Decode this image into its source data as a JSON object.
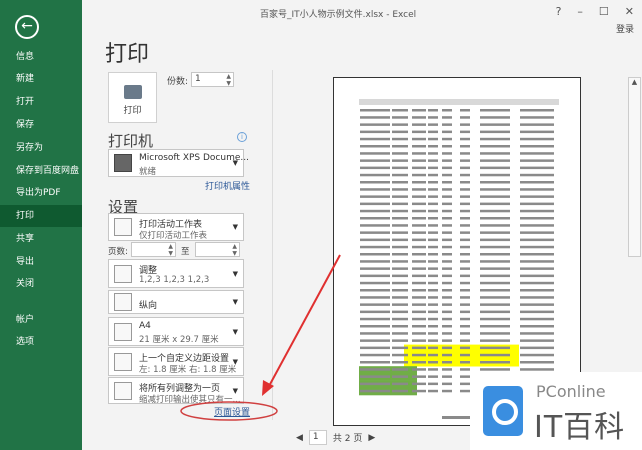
{
  "window": {
    "title": "百家号_IT小人物示例文件.xlsx - Excel",
    "help": "?",
    "minimize": "–",
    "maximize": "☐",
    "close": "✕",
    "login": "登录"
  },
  "sidebar": {
    "back": "←",
    "items": [
      {
        "label": "信息"
      },
      {
        "label": "新建"
      },
      {
        "label": "打开"
      },
      {
        "label": "保存"
      },
      {
        "label": "另存为"
      },
      {
        "label": "保存到百度网盘"
      },
      {
        "label": "导出为PDF"
      },
      {
        "label": "打印"
      },
      {
        "label": "共享"
      },
      {
        "label": "导出"
      },
      {
        "label": "关闭"
      },
      {
        "label": "帐户"
      },
      {
        "label": "选项"
      }
    ]
  },
  "print": {
    "title": "打印",
    "button": "打印",
    "copies_label": "份数:",
    "copies": "1",
    "printer_heading": "打印机",
    "printer_name": "Microsoft XPS Docume...",
    "printer_status": "就绪",
    "printer_props": "打印机属性",
    "settings_heading": "设置",
    "settings": [
      {
        "t1": "打印活动工作表",
        "t2": "仅打印活动工作表"
      },
      {
        "t1": "调整",
        "t2": "1,2,3    1,2,3    1,2,3"
      },
      {
        "t1": "纵向",
        "t2": ""
      },
      {
        "t1": "A4",
        "t2": "21 厘米 x 29.7 厘米"
      },
      {
        "t1": "上一个自定义边距设置",
        "t2": "左: 1.8 厘米    右: 1.8 厘米"
      },
      {
        "t1": "将所有列调整为一页",
        "t2": "缩减打印输出使其只有一..."
      }
    ],
    "pages_label": "页数:",
    "to_label": "至",
    "page_setup": "页面设置"
  },
  "preview": {
    "current_page": "1",
    "total": "共 2 页",
    "highlight_yellow": "#ffff00",
    "highlight_green": "#70ad47"
  },
  "watermark": {
    "brand": "PConline",
    "name": "IT百科"
  },
  "colors": {
    "accent": "#217346",
    "annotation": "#e03030"
  }
}
